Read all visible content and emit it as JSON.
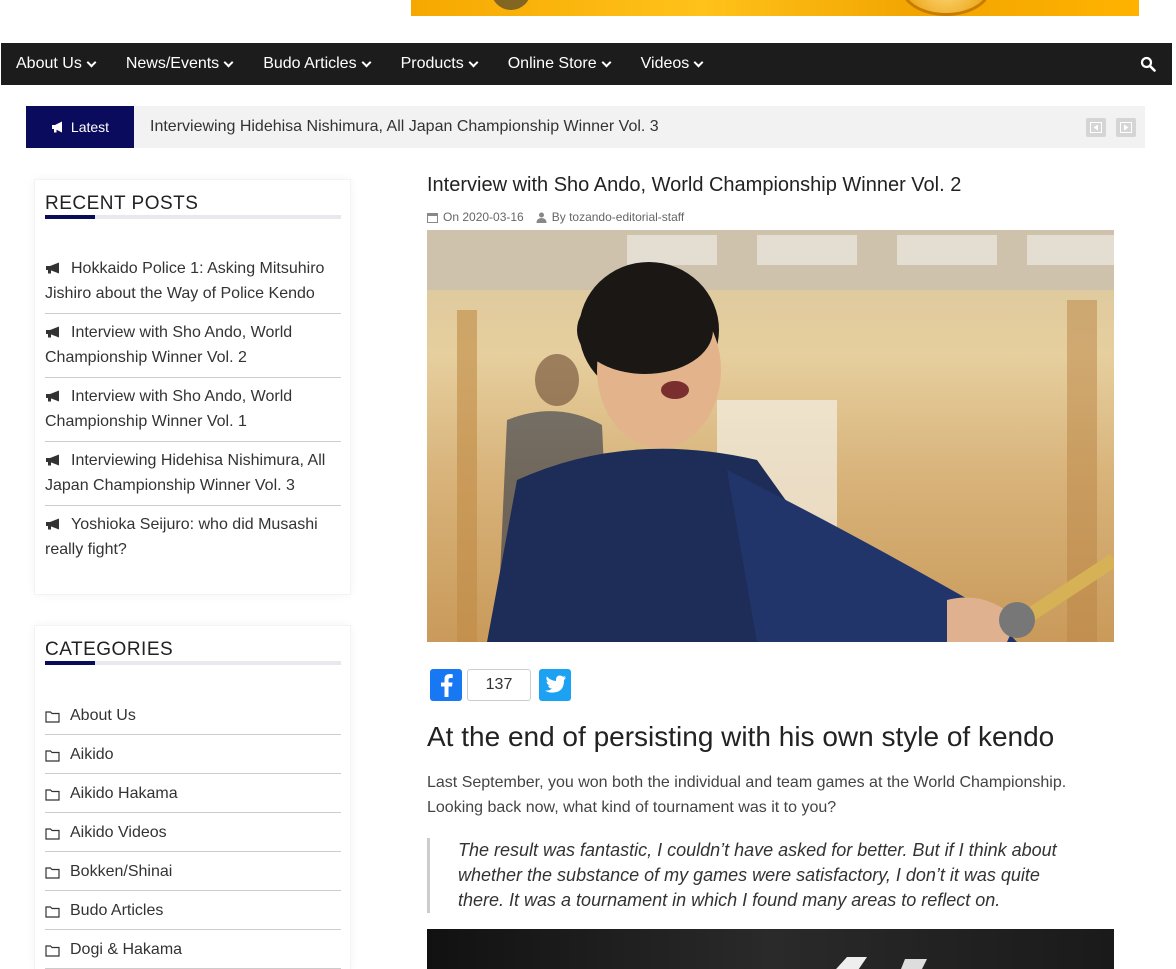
{
  "nav": {
    "items": [
      "About Us",
      "News/Events",
      "Budo Articles",
      "Products",
      "Online Store",
      "Videos"
    ]
  },
  "ticker": {
    "label": "Latest",
    "headline": "Interviewing Hidehisa Nishimura, All Japan Championship Winner Vol. 3"
  },
  "recent_posts": {
    "title": "RECENT  POSTS",
    "items": [
      {
        "line1": "Hokkaido Police 1: Asking Mitsuhiro",
        "line2": "Jishiro about the Way of Police Kendo"
      },
      {
        "line1": "Interview with Sho Ando, World",
        "line2": "Championship Winner Vol. 2"
      },
      {
        "line1": "Interview with Sho Ando, World",
        "line2": "Championship Winner Vol. 1"
      },
      {
        "line1": "Interviewing Hidehisa Nishimura, All",
        "line2": "Japan Championship Winner Vol. 3"
      },
      {
        "line1": "Yoshioka Seijuro: who did Musashi",
        "line2": "really fight?"
      }
    ]
  },
  "categories": {
    "title": "CATEGORIES",
    "items": [
      "About Us",
      "Aikido",
      "Aikido Hakama",
      "Aikido Videos",
      "Bokken/Shinai",
      "Budo Articles",
      "Dogi & Hakama"
    ]
  },
  "article": {
    "title": "Interview with Sho Ando, World Championship Winner Vol. 2",
    "date": "On 2020-03-16",
    "author": "By tozando-editorial-staff",
    "share_count": "137",
    "heading": "At the end of persisting with his own style of kendo",
    "paragraph_line1": "Last September, you won both the individual and team games at the World Championship.",
    "paragraph_line2": "Looking back now, what kind of tournament was it to you?",
    "quote_line1": "The result was fantastic, I couldn’t have asked for better. But if I think about",
    "quote_line2": "whether the substance of my games were satisfactory, I don’t it was quite",
    "quote_line3": "there. It was a tournament in which I found many areas to reflect on."
  },
  "colors": {
    "nav_bg": "#1c1c1c",
    "accent": "#0b0b5e",
    "facebook": "#1877f2",
    "twitter": "#1da1f2"
  },
  "icons": [
    "chevron-down-icon",
    "search-icon",
    "megaphone-icon",
    "prev-icon",
    "next-icon",
    "folder-icon",
    "calendar-icon",
    "user-icon",
    "facebook-icon",
    "twitter-icon"
  ]
}
